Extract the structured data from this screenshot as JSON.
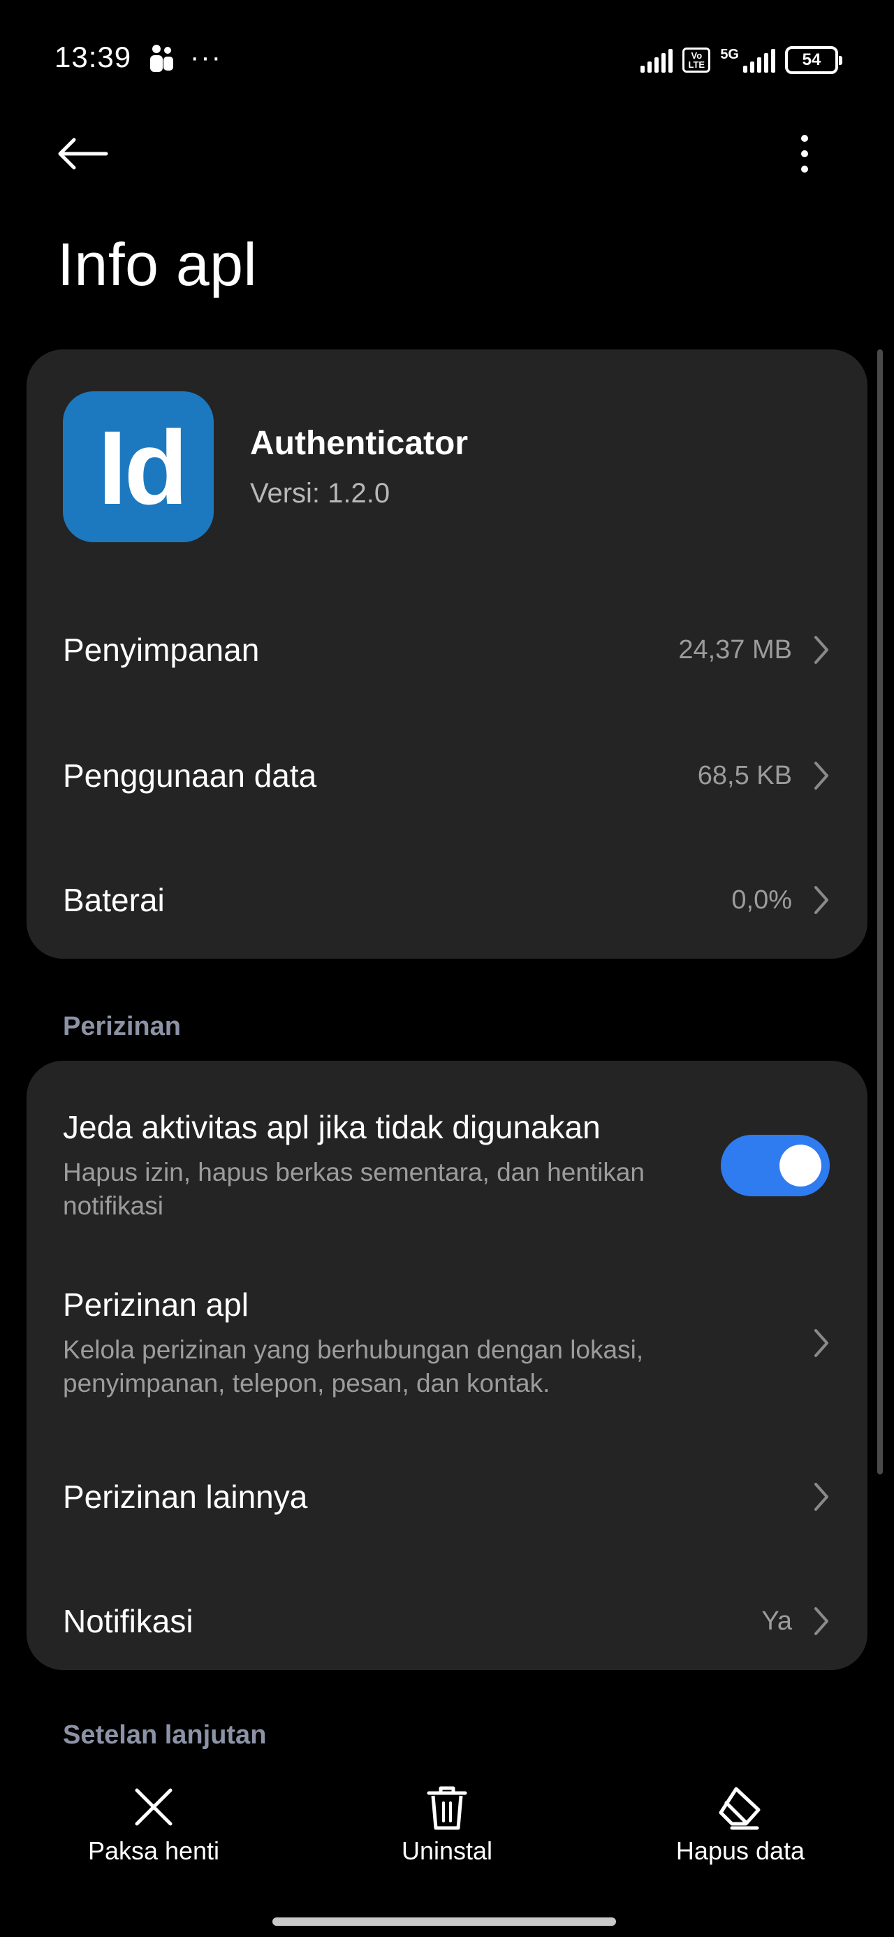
{
  "status_bar": {
    "time": "13:39",
    "more_indicator": "···",
    "network_badge": "Vo LTE",
    "network_type": "5G",
    "battery_percent": "54",
    "icons": [
      "person-icon",
      "signal-icon",
      "volte-icon",
      "signal-5g-icon",
      "battery-icon"
    ]
  },
  "top_bar": {
    "back_icon": "arrow-left-icon",
    "more_icon": "more-vertical-icon",
    "title": "Info apl"
  },
  "app": {
    "icon_text": "Id",
    "icon_color": "#1c79bf",
    "name": "Authenticator",
    "version": "Versi: 1.2.0"
  },
  "usage_rows": [
    {
      "title": "Penyimpanan",
      "value": "24,37 MB"
    },
    {
      "title": "Penggunaan data",
      "value": "68,5 KB"
    },
    {
      "title": "Baterai",
      "value": "0,0%"
    }
  ],
  "permissions": {
    "section_title": "Perizinan",
    "pause_activity": {
      "title": "Jeda aktivitas apl jika tidak digunakan",
      "description": "Hapus izin, hapus berkas sementara, dan hentikan notifikasi",
      "enabled": true
    },
    "app_permissions": {
      "title": "Perizinan apl",
      "description": "Kelola perizinan yang berhubungan dengan lokasi, penyimpanan, telepon, pesan, dan kontak."
    },
    "other_permissions": {
      "title": "Perizinan lainnya"
    },
    "notifications": {
      "title": "Notifikasi",
      "value": "Ya"
    }
  },
  "advanced": {
    "section_title": "Setelan lanjutan"
  },
  "actions": [
    {
      "label": "Paksa henti",
      "icon": "close-icon"
    },
    {
      "label": "Uninstal",
      "icon": "trash-icon"
    },
    {
      "label": "Hapus data",
      "icon": "eraser-icon"
    }
  ],
  "colors": {
    "background": "#000000",
    "card": "#242424",
    "accent": "#2f7bf0",
    "section_title": "#8d93a6",
    "secondary_text": "#9c9c9c"
  }
}
